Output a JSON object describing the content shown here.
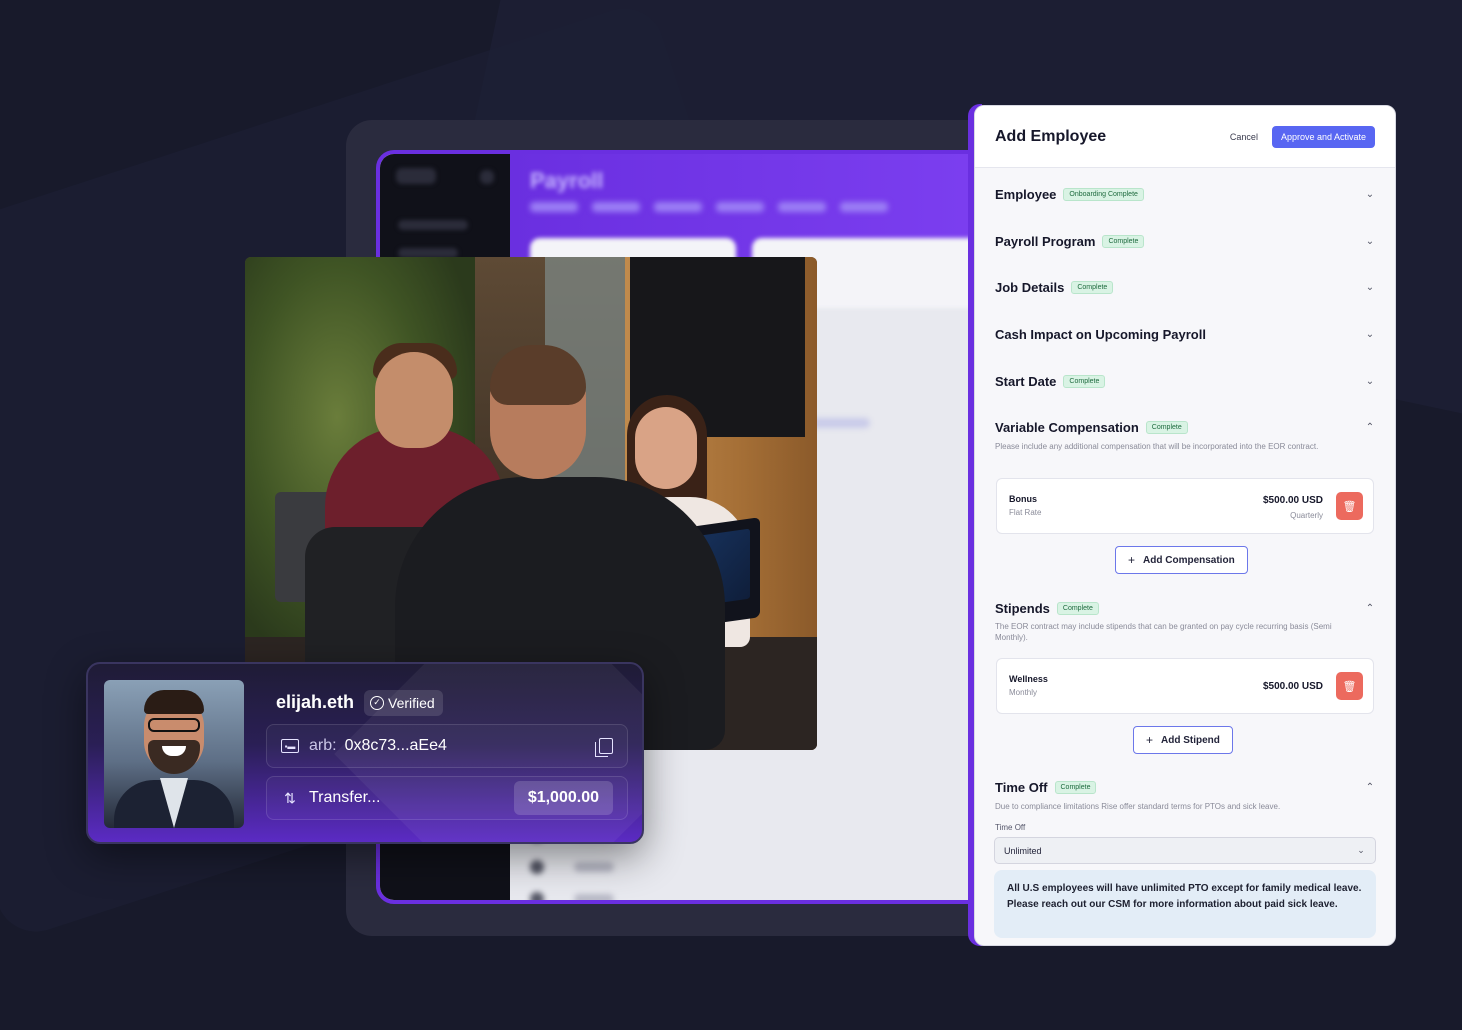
{
  "background_app": {
    "title": "Payroll"
  },
  "wallet_card": {
    "name": "elijah.eth",
    "verified_label": "Verified",
    "address_prefix": "arb:",
    "address": "0x8c73...aEe4",
    "transfer_label": "Transfer...",
    "amount": "$1,000.00"
  },
  "panel": {
    "title": "Add Employee",
    "cancel_label": "Cancel",
    "approve_label": "Approve and Activate",
    "sections": {
      "employee": {
        "title": "Employee",
        "badge": "Onboarding Complete"
      },
      "payroll_program": {
        "title": "Payroll Program",
        "badge": "Complete"
      },
      "job_details": {
        "title": "Job Details",
        "badge": "Complete"
      },
      "cash_impact": {
        "title": "Cash Impact on Upcoming Payroll"
      },
      "start_date": {
        "title": "Start Date",
        "badge": "Complete"
      },
      "variable_comp": {
        "title": "Variable Compensation",
        "badge": "Complete",
        "description": "Please include any additional compensation that will be incorporated into the EOR contract.",
        "item": {
          "name": "Bonus",
          "type": "Flat Rate",
          "amount": "$500.00 USD",
          "frequency": "Quarterly"
        },
        "add_label": "Add Compensation"
      },
      "stipends": {
        "title": "Stipends",
        "badge": "Complete",
        "description": "The EOR contract may include stipends that can be granted on pay cycle recurring basis (Semi Monthly).",
        "item": {
          "name": "Wellness",
          "type": "Monthly",
          "amount": "$500.00 USD"
        },
        "add_label": "Add Stipend"
      },
      "time_off": {
        "title": "Time Off",
        "badge": "Complete",
        "description": "Due to compliance limitations Rise offer standard terms for PTOs and sick leave.",
        "field_label": "Time Off",
        "selected": "Unlimited",
        "note": "All U.S employees will have unlimited PTO except for family medical leave. Please reach out our CSM for more information about paid sick leave."
      }
    }
  },
  "colors": {
    "background": "#181a2b",
    "accent_purple": "#6a2fe0",
    "approve_blue": "#5866f2",
    "badge_green": "#d9f3e4",
    "delete_red": "#ec6a5e"
  },
  "icons": [
    "check-circle-icon",
    "id-card-icon",
    "copy-icon",
    "transfer-icon",
    "chevron-down-icon",
    "chevron-up-icon",
    "trash-icon",
    "plus-icon"
  ]
}
